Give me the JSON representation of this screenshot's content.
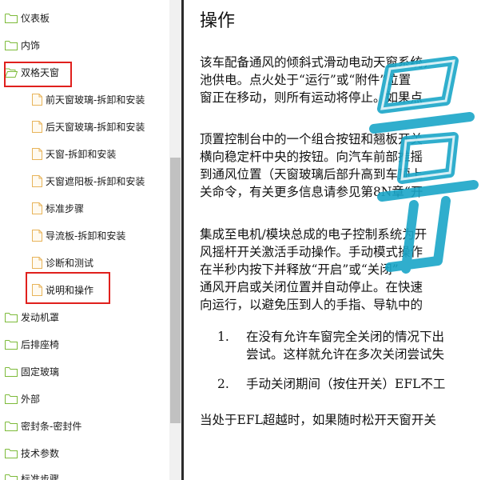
{
  "tree": {
    "items": [
      {
        "label": "仪表板",
        "type": "folder"
      },
      {
        "label": "内饰",
        "type": "folder"
      },
      {
        "label": "双格天窗",
        "type": "folder-open"
      },
      {
        "label": "前天窗玻璃-拆卸和安装",
        "type": "doc"
      },
      {
        "label": "后天窗玻璃-拆卸和安装",
        "type": "doc"
      },
      {
        "label": "天窗-拆卸和安装",
        "type": "doc"
      },
      {
        "label": "天窗遮阳板-拆卸和安装",
        "type": "doc"
      },
      {
        "label": "标准步骤",
        "type": "doc"
      },
      {
        "label": "导流板-拆卸和安装",
        "type": "doc"
      },
      {
        "label": "诊断和测试",
        "type": "doc"
      },
      {
        "label": "说明和操作",
        "type": "doc"
      },
      {
        "label": "发动机罩",
        "type": "folder"
      },
      {
        "label": "后排座椅",
        "type": "folder"
      },
      {
        "label": "固定玻璃",
        "type": "folder"
      },
      {
        "label": "外部",
        "type": "folder"
      },
      {
        "label": "密封条-密封件",
        "type": "folder"
      },
      {
        "label": "技术参数",
        "type": "folder"
      },
      {
        "label": "标准步骤",
        "type": "folder"
      }
    ]
  },
  "content": {
    "title": "操作",
    "para1": [
      "该车配备通风的倾斜式滑动电动天窗系统，",
      "池供电。点火处于“运行”或“附件”位置",
      "窗正在移动，则所有运动将停止。如果点"
    ],
    "para2": [
      "顶置控制台中的一个组合按钮和翘板开关",
      "横向稳定杆中央的按钮。向汽车前部推摇",
      "到通风位置（天窗玻璃后部升高到车顶上",
      "关命令，有关更多信息请参见第8N章“开"
    ],
    "para3": [
      "集成至电机/模块总成的电子控制系统为开",
      "风摇杆开关激活手动操作。手动模式操作",
      "在半秒内按下并释放“开启”或“关闭”",
      "通风开启或关闭位置并自动停止。在快速",
      "向运行，以避免压到人的手指、导轨中的"
    ],
    "list": [
      {
        "num": "1.",
        "lines": [
          "在没有允许车窗完全关闭的情况下出",
          "尝试。这样就允许在多次关闭尝试失"
        ]
      },
      {
        "num": "2.",
        "lines": [
          "手动关闭期间（按住开关）EFL不工"
        ]
      }
    ],
    "para4": [
      "当处于EFL超越时，如果随时松开天窗开关"
    ]
  },
  "colors": {
    "folder": "#7dbb3a",
    "highlight": "#e0201d",
    "watermark": "#1aa6c8"
  }
}
